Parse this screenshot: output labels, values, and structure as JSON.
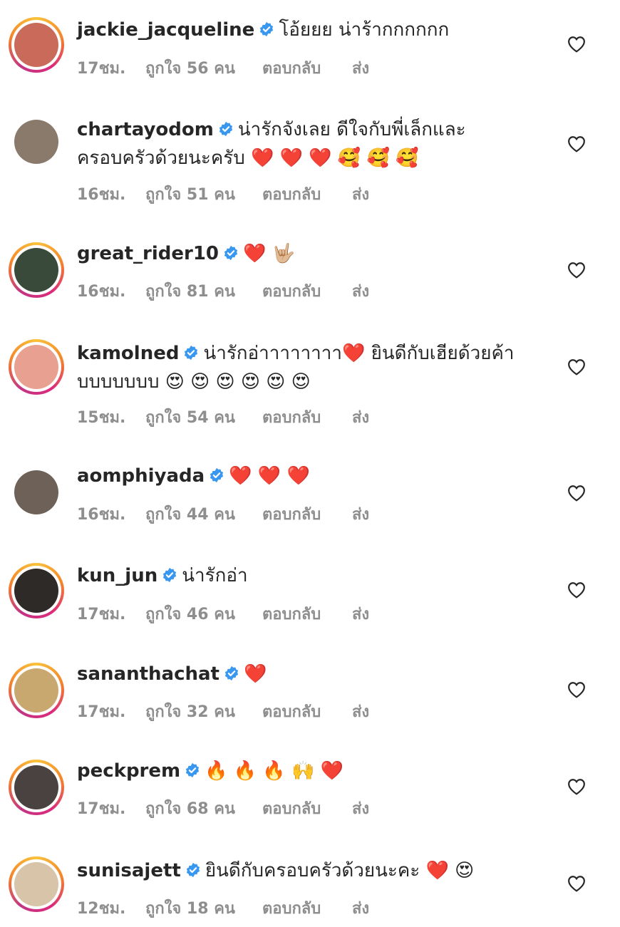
{
  "comments": [
    {
      "username": "jackie_jacqueline",
      "text1": "โอ้ยยย น่าร้ากกกกกก",
      "text2": "",
      "time": "17ชม.",
      "likes": "ถูกใจ 56 คน",
      "reply": "ตอบกลับ",
      "send": "ส่ง",
      "ring": true,
      "avatar_color": "#c96a5a"
    },
    {
      "username": "chartayodom",
      "text1": "น่ารักจังเลย ดีใจกับพี่เล็กและ",
      "text2": "ครอบครัวด้วยนะครับ ❤️ ❤️ ❤️ 🥰 🥰 🥰",
      "time": "16ชม.",
      "likes": "ถูกใจ 51 คน",
      "reply": "ตอบกลับ",
      "send": "ส่ง",
      "ring": false,
      "avatar_color": "#8a7a6c"
    },
    {
      "username": "great_rider10",
      "text1": "❤️ 🤟🏼",
      "text2": "",
      "time": "16ชม.",
      "likes": "ถูกใจ 81 คน",
      "reply": "ตอบกลับ",
      "send": "ส่ง",
      "ring": true,
      "avatar_color": "#3a4a3a"
    },
    {
      "username": "kamolned",
      "text1": "น่ารักอ่าาาาาาาา❤️ ยินดีกับเฮียด้วยค้า",
      "text2": "บบบบบบบ 😍 😍 😍 😍 😍 😍",
      "time": "15ชม.",
      "likes": "ถูกใจ 54 คน",
      "reply": "ตอบกลับ",
      "send": "ส่ง",
      "ring": true,
      "avatar_color": "#e8a090"
    },
    {
      "username": "aomphiyada",
      "text1": "❤️ ❤️ ❤️",
      "text2": "",
      "time": "16ชม.",
      "likes": "ถูกใจ 44 คน",
      "reply": "ตอบกลับ",
      "send": "ส่ง",
      "ring": false,
      "avatar_color": "#6e6258"
    },
    {
      "username": "kun_jun",
      "text1": "น่ารักอ่า",
      "text2": "",
      "time": "17ชม.",
      "likes": "ถูกใจ 46 คน",
      "reply": "ตอบกลับ",
      "send": "ส่ง",
      "ring": true,
      "avatar_color": "#2e2a28"
    },
    {
      "username": "sananthachat",
      "text1": "❤️",
      "text2": "",
      "time": "17ชม.",
      "likes": "ถูกใจ 32 คน",
      "reply": "ตอบกลับ",
      "send": "ส่ง",
      "ring": true,
      "avatar_color": "#c9a870"
    },
    {
      "username": "peckprem",
      "text1": "🔥 🔥 🔥 🙌 ❤️",
      "text2": "",
      "time": "17ชม.",
      "likes": "ถูกใจ 68 คน",
      "reply": "ตอบกลับ",
      "send": "ส่ง",
      "ring": true,
      "avatar_color": "#4a4240"
    },
    {
      "username": "sunisajett",
      "text1": "ยินดีกับครอบครัวด้วยนะคะ ❤️ 😍",
      "text2": "",
      "time": "12ชม.",
      "likes": "ถูกใจ 18 คน",
      "reply": "ตอบกลับ",
      "send": "ส่ง",
      "ring": true,
      "avatar_color": "#d8c4a8"
    }
  ],
  "colors": {
    "username": "#262626",
    "meta": "#8e8e8e",
    "verified": "#3897f0",
    "heart_outline": "#262626"
  },
  "icons": {
    "verified": "verified-badge-icon",
    "like": "heart-outline-icon"
  }
}
